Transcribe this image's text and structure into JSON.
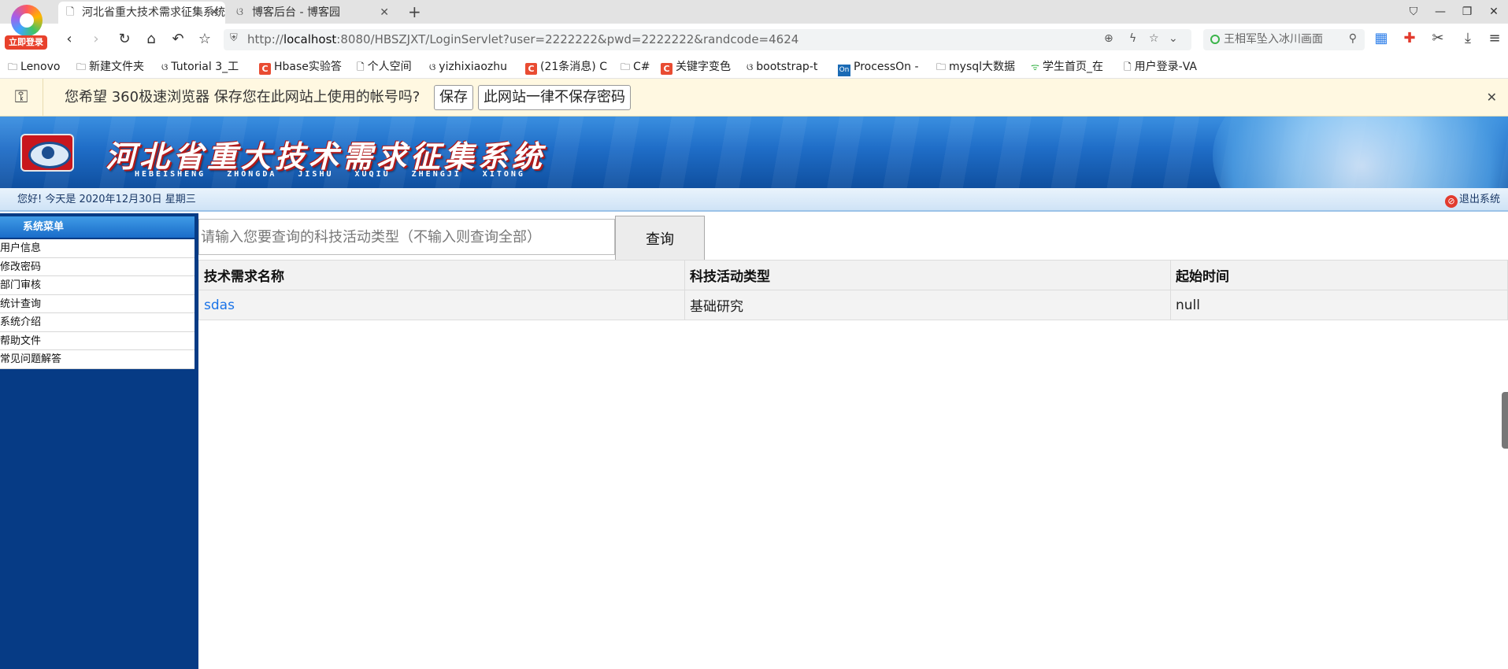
{
  "browser": {
    "login_badge": "立即登录",
    "tabs": [
      {
        "title": "河北省重大技术需求征集系统",
        "icon": "page-icon"
      },
      {
        "title": "博客后台 - 博客园",
        "icon": "blog-icon"
      }
    ],
    "address": {
      "url_prefix": "http://",
      "url_host": "localhost",
      "url_rest": ":8080/HBSZJXT/LoginServlet?user=2222222&pwd=2222222&randcode=4624"
    },
    "side_search": "王相军坠入冰川画面",
    "bookmarks": [
      {
        "label": "Lenovo",
        "icon": "folder-icon"
      },
      {
        "label": "新建文件夹",
        "icon": "folder-icon"
      },
      {
        "label": "Tutorial 3_工",
        "icon": "blog-icon"
      },
      {
        "label": "Hbase实验答",
        "icon": "csdn-icon"
      },
      {
        "label": "个人空间",
        "icon": "page-icon"
      },
      {
        "label": "yizhixiaozhu",
        "icon": "blog-icon"
      },
      {
        "label": "(21条消息) C",
        "icon": "csdn-icon"
      },
      {
        "label": "C#",
        "icon": "folder-icon"
      },
      {
        "label": "关键字变色",
        "icon": "csdn-icon"
      },
      {
        "label": "bootstrap-t",
        "icon": "blog-icon"
      },
      {
        "label": "ProcessOn -",
        "icon": "processon-icon"
      },
      {
        "label": "mysql大数据",
        "icon": "folder-icon"
      },
      {
        "label": "学生首页_在",
        "icon": "leaf-icon"
      },
      {
        "label": "用户登录-VA",
        "icon": "page-icon"
      }
    ],
    "save_bar": {
      "message": "您希望 360极速浏览器 保存您在此网站上使用的帐号吗?",
      "save_label": "保存",
      "never_label": "此网站一律不保存密码"
    }
  },
  "app": {
    "banner_title": "河北省重大技术需求征集系统",
    "banner_pinyin": "HEBEISHENG ZHONGDA JISHU XUQIU ZHENGJI XITONG",
    "greeting": "您好! 今天是 2020年12月30日 星期三",
    "logout_label": "退出系统",
    "menu_title": "系统菜单",
    "menu": [
      "用户信息",
      "修改密码",
      "部门审核",
      "统计查询",
      "系统介绍",
      "帮助文件",
      "常见问题解答"
    ],
    "search": {
      "placeholder": "请输入您要查询的科技活动类型（不输入则查询全部）",
      "button_label": "查询"
    },
    "table": {
      "headers": [
        "技术需求名称",
        "科技活动类型",
        "起始时间"
      ],
      "rows": [
        [
          "sdas",
          "基础研究",
          "null"
        ]
      ]
    }
  }
}
